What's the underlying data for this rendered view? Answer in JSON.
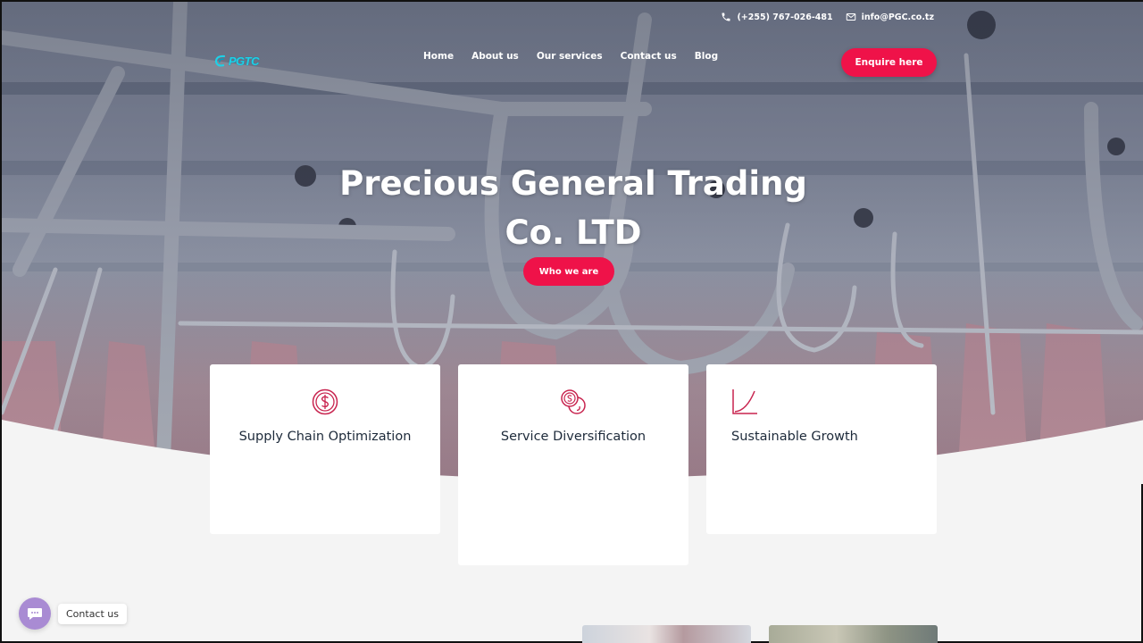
{
  "topbar": {
    "phone": "(+255) 767-026-481",
    "email": "info@PGC.co.tz"
  },
  "logo": {
    "text": "PGTC"
  },
  "nav": {
    "items": [
      {
        "label": "Home"
      },
      {
        "label": "About us"
      },
      {
        "label": "Our services"
      },
      {
        "label": "Contact us"
      },
      {
        "label": "Blog"
      }
    ],
    "cta_label": "Enquire here"
  },
  "hero": {
    "title_line1": "Precious General Trading",
    "title_line2": "Co. LTD",
    "button_label": "Who we are"
  },
  "features": [
    {
      "title": "Supply Chain Optimization",
      "icon": "dollar-coin-icon"
    },
    {
      "title": "Service Diversification",
      "icon": "coins-icon"
    },
    {
      "title": "Sustainable Growth",
      "icon": "growth-chart-icon"
    }
  ],
  "contact_widget": {
    "label": "Contact us",
    "icon": "chat-bubble-icon"
  },
  "colors": {
    "accent": "#ef1249",
    "icon_accent": "#c8244f",
    "heading": "#1d2a3a",
    "page_bg": "#f4f4f4",
    "chat_widget": "#a98bd3"
  }
}
